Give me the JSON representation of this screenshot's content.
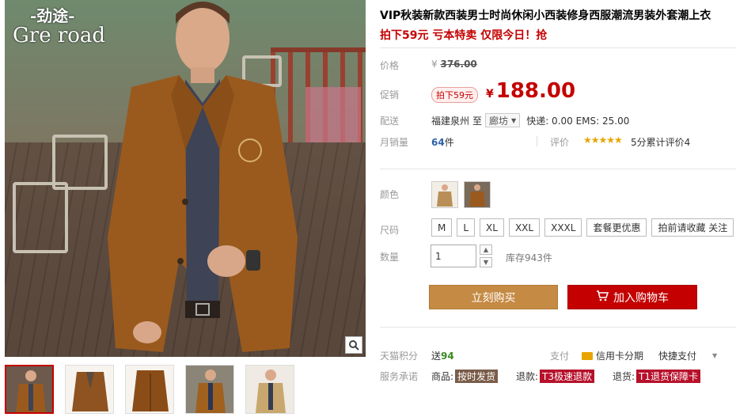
{
  "gallery": {
    "logo_cn": "-劲途-",
    "logo_en": "Gre road",
    "thumbnails": [
      "thumb-1",
      "thumb-2",
      "thumb-3",
      "thumb-4",
      "thumb-5"
    ],
    "zoom_icon": "magnifier-icon"
  },
  "product": {
    "title": "VIP秋装新款西装男士时尚休闲小西装修身西服潮流男装外套潮上衣",
    "subtitle": "拍下59元 亏本特卖 仅限今日！抢"
  },
  "price": {
    "label": "价格",
    "currency": "¥",
    "original": "376.00",
    "promo_label": "促销",
    "promo_badge": "拍下59元",
    "promo_price": "188.00"
  },
  "shipping": {
    "label": "配送",
    "from": "福建泉州",
    "to_word": "至",
    "to_city": "廊坊",
    "fees": "快递: 0.00 EMS: 25.00"
  },
  "sales": {
    "label": "月销量",
    "count": "64",
    "unit": "件",
    "rate_label": "评价",
    "stars": "★★★★★",
    "rate_text": "5分累计评价4"
  },
  "options": {
    "color_label": "颜色",
    "size_label": "尺码",
    "sizes": [
      "M",
      "L",
      "XL",
      "XXL",
      "XXXL",
      "套餐更优惠",
      "拍前请收藏 关注"
    ],
    "qty_label": "数量",
    "qty_value": "1",
    "stock": "库存943件"
  },
  "actions": {
    "buy_now": "立刻购买",
    "add_cart": "加入购物车"
  },
  "extras": {
    "points_label": "天猫积分",
    "points_prefix": "送",
    "points_value": "94",
    "pay_label": "支付",
    "pay_card": "信用卡分期",
    "pay_fast": "快捷支付",
    "promise_label": "服务承诺",
    "promise": [
      {
        "prefix": "商品:",
        "tag": "按时发货",
        "style": "brown"
      },
      {
        "prefix": "退款:",
        "tag": "T3极速退款",
        "style": "red"
      },
      {
        "prefix": "退货:",
        "tag": "T1退货保障卡",
        "style": "red"
      }
    ]
  },
  "colors": {
    "accent_red": "#c40000",
    "buy_button": "#c58a43",
    "link_blue": "#2c61a8"
  }
}
